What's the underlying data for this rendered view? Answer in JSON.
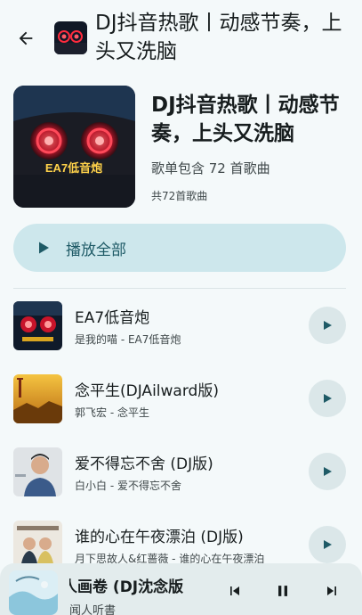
{
  "header": {
    "back_icon": "arrow-back-icon",
    "title": "DJ抖音热歌丨动感节奏，上头又洗脑"
  },
  "playlist": {
    "title": "DJ抖音热歌丨动感节奏，上头又洗脑",
    "description": "歌单包含 72 首歌曲",
    "count_text": "共72首歌曲",
    "cover_caption": "EA7低音炮"
  },
  "play_all": {
    "icon": "play-icon",
    "label": "播放全部"
  },
  "songs": [
    {
      "title": "EA7低音炮",
      "subtitle": "是我的喵 - EA7低音炮"
    },
    {
      "title": "念平生(DJAilward版)",
      "subtitle": "郭飞宏 - 念平生"
    },
    {
      "title": "爱不得忘不舍 (DJ版)",
      "subtitle": "白小白 - 爱不得忘不舍"
    },
    {
      "title": "谁的心在午夜漂泊 (DJ版)",
      "subtitle": "月下思故人&红蔷薇 - 谁的心在午夜漂泊"
    }
  ],
  "mini_player": {
    "title": "人画卷 (DJ沈念版",
    "artist": "闻人听書_",
    "controls": [
      "skip-previous-icon",
      "pause-icon",
      "skip-next-icon"
    ]
  },
  "colors": {
    "background": "#f4f9fa",
    "accent": "#1e5a66",
    "play_all_bg": "#cde7ec",
    "row_button_bg": "#dbe7e9",
    "mini_player_bg": "#e3eced"
  }
}
